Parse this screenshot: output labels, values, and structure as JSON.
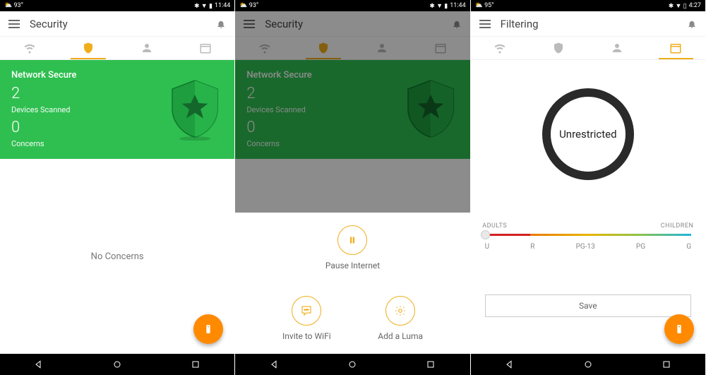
{
  "screens": [
    {
      "statusbar": {
        "temp": "93°",
        "time": "11:44"
      },
      "appbar_title": "Security",
      "tabs_active": 1,
      "greencard": {
        "title": "Network Secure",
        "devices_count": "2",
        "devices_label": "Devices Scanned",
        "concerns_count": "0",
        "concerns_label": "Concerns"
      },
      "body_text": "No Concerns"
    },
    {
      "statusbar": {
        "temp": "93°",
        "time": "11:44"
      },
      "appbar_title": "Security",
      "tabs_active": 1,
      "greencard": {
        "title": "Network Secure",
        "devices_count": "2",
        "devices_label": "Devices Scanned",
        "concerns_count": "0",
        "concerns_label": "Concerns"
      },
      "sheet": {
        "pause": "Pause Internet",
        "invite": "Invite to WiFi",
        "add": "Add a Luma"
      }
    },
    {
      "statusbar": {
        "temp": "95°",
        "time": "4:27"
      },
      "appbar_title": "Filtering",
      "tabs_active": 3,
      "ring_label": "Unrestricted",
      "slider": {
        "left_label": "ADULTS",
        "right_label": "CHILDREN",
        "ticks": [
          "U",
          "R",
          "PG-13",
          "PG",
          "G"
        ]
      },
      "save_label": "Save"
    }
  ],
  "icons": {
    "wifi": "wifi-icon",
    "shield": "shield-icon",
    "person": "person-icon",
    "calendar": "calendar-icon",
    "bell": "bell-icon",
    "pause": "pause-icon",
    "chat": "chat-icon",
    "gear": "gear-icon",
    "remote": "remote-icon"
  },
  "colors": {
    "accent": "#f0ad1d",
    "green": "#2fbf50",
    "fab": "#ff8a00"
  }
}
